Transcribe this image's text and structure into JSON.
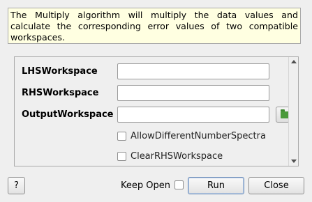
{
  "description": {
    "line1": "The Multiply algorithm will multiply the data values and",
    "line2": "calculate the corresponding error values of two compatible",
    "line3": "workspaces."
  },
  "properties": [
    {
      "label": "LHSWorkspace",
      "value": ""
    },
    {
      "label": "RHSWorkspace",
      "value": ""
    },
    {
      "label": "OutputWorkspace",
      "value": ""
    }
  ],
  "options": [
    {
      "label": "AllowDifferentNumberSpectra",
      "checked": false
    },
    {
      "label": "ClearRHSWorkspace",
      "checked": false
    }
  ],
  "footer": {
    "help_label": "?",
    "keep_open_label": "Keep Open",
    "keep_open_checked": false,
    "run_label": "Run",
    "close_label": "Close"
  },
  "icons": {
    "browse": "folder-icon"
  }
}
